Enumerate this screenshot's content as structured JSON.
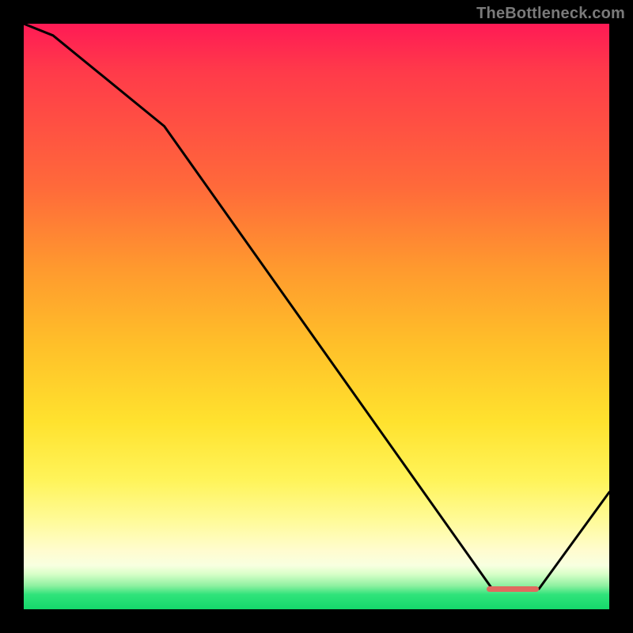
{
  "watermark": "TheBottleneck.com",
  "colors": {
    "background": "#000000",
    "line": "#000000",
    "marker": "#e06a5f",
    "watermark_text": "#7a7a7a"
  },
  "chart_data": {
    "type": "line",
    "title": "",
    "xlabel": "",
    "ylabel": "",
    "xlim": [
      0,
      100
    ],
    "ylim": [
      0,
      100
    ],
    "grid": false,
    "legend": false,
    "series": [
      {
        "name": "bottleneck-curve",
        "x": [
          0,
          5,
          24,
          80,
          88,
          100
        ],
        "y": [
          100,
          98,
          82.5,
          3.5,
          3.5,
          20
        ]
      }
    ],
    "annotations": [
      {
        "name": "optimal-range-marker",
        "x_start": 79,
        "x_end": 88,
        "y": 3.5
      }
    ]
  }
}
